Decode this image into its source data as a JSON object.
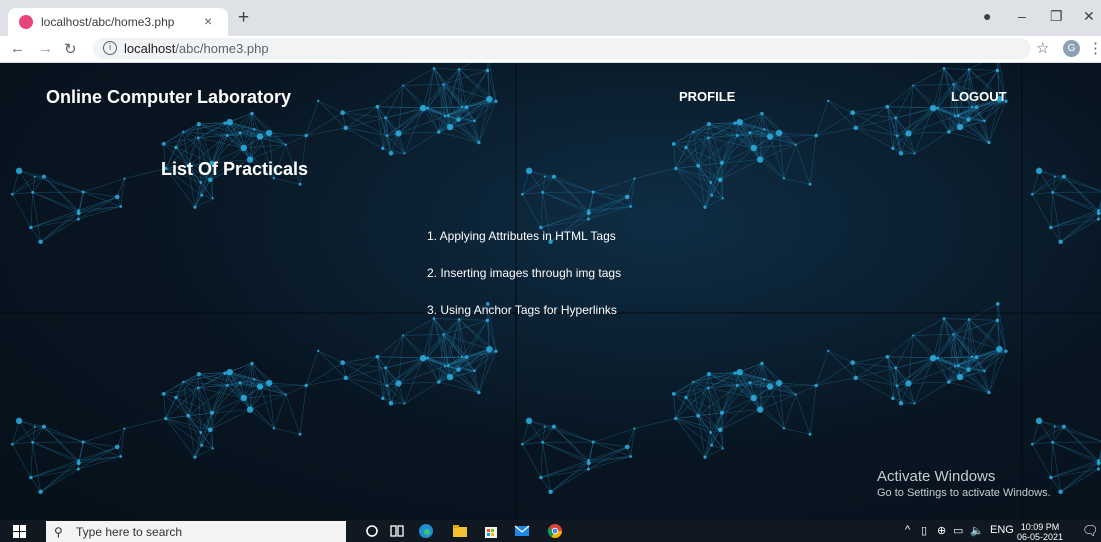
{
  "browser": {
    "tab_title": "localhost/abc/home3.php",
    "new_tab": "+",
    "close_tab": "×",
    "url_host": "localhost",
    "url_path": "/abc/home3.php",
    "avatar_letter": "G"
  },
  "site": {
    "title": "Online Computer Laboratory",
    "nav": {
      "profile": "PROFILE",
      "logout": "LOGOUT"
    },
    "section_title": "List Of Practicals",
    "practicals": [
      "1. Applying Attributes in HTML Tags",
      "2. Inserting images through img tags",
      "3. Using Anchor Tags for Hyperlinks"
    ]
  },
  "watermark": {
    "title": "Activate Windows",
    "subtitle": "Go to Settings to activate Windows."
  },
  "taskbar": {
    "search_placeholder": "Type here to search",
    "language": "ENG",
    "time": "10:09 PM",
    "date": "06-05-2021"
  },
  "colors": {
    "page_bg": "#081521",
    "network_line": "#1f6f96",
    "network_node": "#2bb0e3",
    "taskbar": "#101821"
  },
  "icons": [
    "favicon-icon",
    "close-icon",
    "plus-icon",
    "back-icon",
    "forward-icon",
    "reload-icon",
    "info-icon",
    "star-icon",
    "menu-icon",
    "windows-start-icon",
    "search-icon",
    "cortana-icon",
    "task-view-icon",
    "edge-icon",
    "file-explorer-icon",
    "store-icon",
    "mail-icon",
    "chrome-icon",
    "chevron-up-icon",
    "network-icon",
    "volume-icon",
    "notification-icon"
  ]
}
